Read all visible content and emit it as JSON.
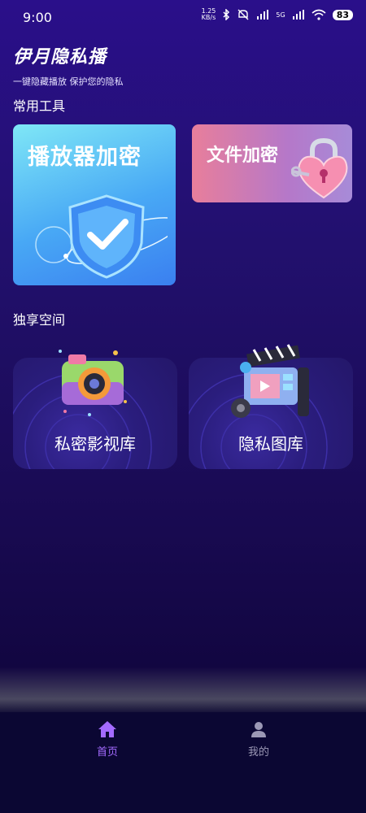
{
  "status_bar": {
    "time": "9:00",
    "net_speed": "1.25",
    "net_unit": "KB/s",
    "network": "5G",
    "battery": "83"
  },
  "header": {
    "title": "伊月隐私播",
    "subtitle": "一键隐藏播放 保护您的隐私"
  },
  "tools": {
    "section_title": "常用工具",
    "player_label": "播放器加密",
    "file_label": "文件加密"
  },
  "spaces": {
    "section_title": "独享空间",
    "video_label": "私密影视库",
    "gallery_label": "隐私图库"
  },
  "nav": {
    "home_label": "首页",
    "mine_label": "我的"
  },
  "colors": {
    "accent": "#a46bff",
    "background": "#22106e"
  },
  "icons": [
    "shield-check-icon",
    "heart-lock-icon",
    "camera-icon",
    "film-clapper-icon",
    "home-icon",
    "user-icon"
  ]
}
